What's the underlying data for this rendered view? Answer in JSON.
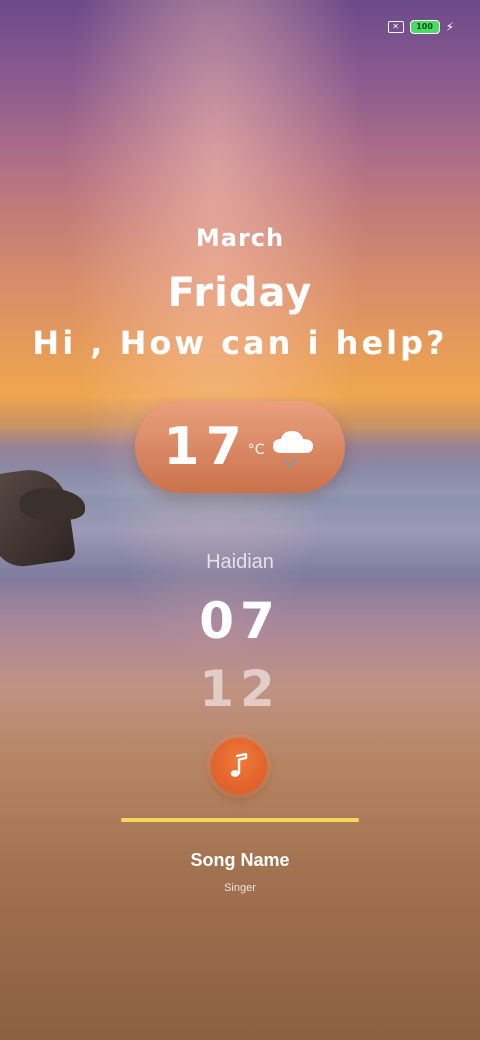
{
  "status_bar": {
    "sim_icon": "no-sim-icon",
    "battery_level": "100",
    "charging_icon": "lightning-bolt-icon",
    "battery_color": "#4cd964"
  },
  "greeting": {
    "month": "March",
    "day": "Friday",
    "message": "Hi , How can i help?"
  },
  "weather": {
    "temperature": "17",
    "unit": "°C",
    "icon": "rain-cloud-icon"
  },
  "location": {
    "city": "Haidian"
  },
  "clock": {
    "hour": "07",
    "minute": "12"
  },
  "music": {
    "icon": "music-note-icon",
    "accent_color": "#e8672f",
    "progress": 1.0,
    "progress_color": "#f4d35e",
    "song_name": "Song Name",
    "singer": "Singer"
  }
}
